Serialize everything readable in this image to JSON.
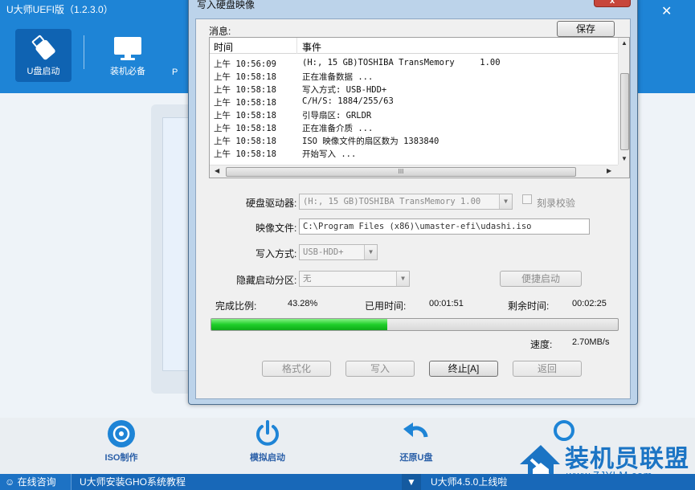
{
  "app": {
    "title": "U大师UEFI版（1.2.3.0）",
    "nav": [
      {
        "label": "U盘启动",
        "icon": "usb-drive-icon",
        "active": true
      },
      {
        "label": "装机必备",
        "icon": "monitor-icon",
        "active": false
      },
      {
        "label": "P",
        "icon": "pe-icon",
        "active": false
      }
    ],
    "bottom_buttons": [
      {
        "label": "ISO制作",
        "icon": "disc-icon"
      },
      {
        "label": "模拟启动",
        "icon": "power-icon"
      },
      {
        "label": "还原U盘",
        "icon": "restore-arrow-icon"
      },
      {
        "label": "",
        "icon": "circle-icon"
      }
    ],
    "status": {
      "consult": "在线咨询",
      "tutorial": "U大师安装GHO系统教程",
      "arrow": "▼",
      "news": "U大师4.5.0上线啦"
    },
    "watermark": {
      "text": "装机员联盟",
      "url": "www.ZJYLM.com"
    },
    "colors": {
      "header": "#1e84d6",
      "status_bar": "#1868b8",
      "progress": "#1fcf2a"
    }
  },
  "dialog": {
    "title": "写入硬盘映像",
    "close_label": "x",
    "messages_label": "消息:",
    "save_label": "保存",
    "log": {
      "columns": [
        "时间",
        "事件"
      ],
      "rows": [
        {
          "time": "上午 10:56:09",
          "event": "(H:, 15 GB)TOSHIBA TransMemory     1.00"
        },
        {
          "time": "上午 10:58:18",
          "event": "正在准备数据 ..."
        },
        {
          "time": "上午 10:58:18",
          "event": "写入方式: USB-HDD+"
        },
        {
          "time": "上午 10:58:18",
          "event": "C/H/S: 1884/255/63"
        },
        {
          "time": "上午 10:58:18",
          "event": "引导扇区: GRLDR"
        },
        {
          "time": "上午 10:58:18",
          "event": "正在准备介质 ..."
        },
        {
          "time": "上午 10:58:18",
          "event": "ISO 映像文件的扇区数为 1383840"
        },
        {
          "time": "上午 10:58:18",
          "event": "开始写入 ..."
        }
      ],
      "hscroll_grip": "III"
    },
    "drive": {
      "label": "硬盘驱动器:",
      "value": "(H:, 15 GB)TOSHIBA TransMemory    1.00",
      "verify_label": "刻录校验"
    },
    "image": {
      "label": "映像文件:",
      "value": "C:\\Program Files (x86)\\umaster-efi\\udashi.iso"
    },
    "write_mode": {
      "label": "写入方式:",
      "value": "USB-HDD+"
    },
    "hidden_partition": {
      "label": "隐藏启动分区:",
      "value": "无"
    },
    "quick_boot_label": "便捷启动",
    "progress": {
      "percent_label": "完成比例:",
      "percent_value": "43.28%",
      "percent": 43.28,
      "elapsed_label": "已用时间:",
      "elapsed_value": "00:01:51",
      "remaining_label": "剩余时间:",
      "remaining_value": "00:02:25",
      "speed_label": "速度:",
      "speed_value": "2.70MB/s"
    },
    "buttons": {
      "format": "格式化",
      "write": "写入",
      "stop": "终止[A]",
      "back": "返回"
    }
  }
}
